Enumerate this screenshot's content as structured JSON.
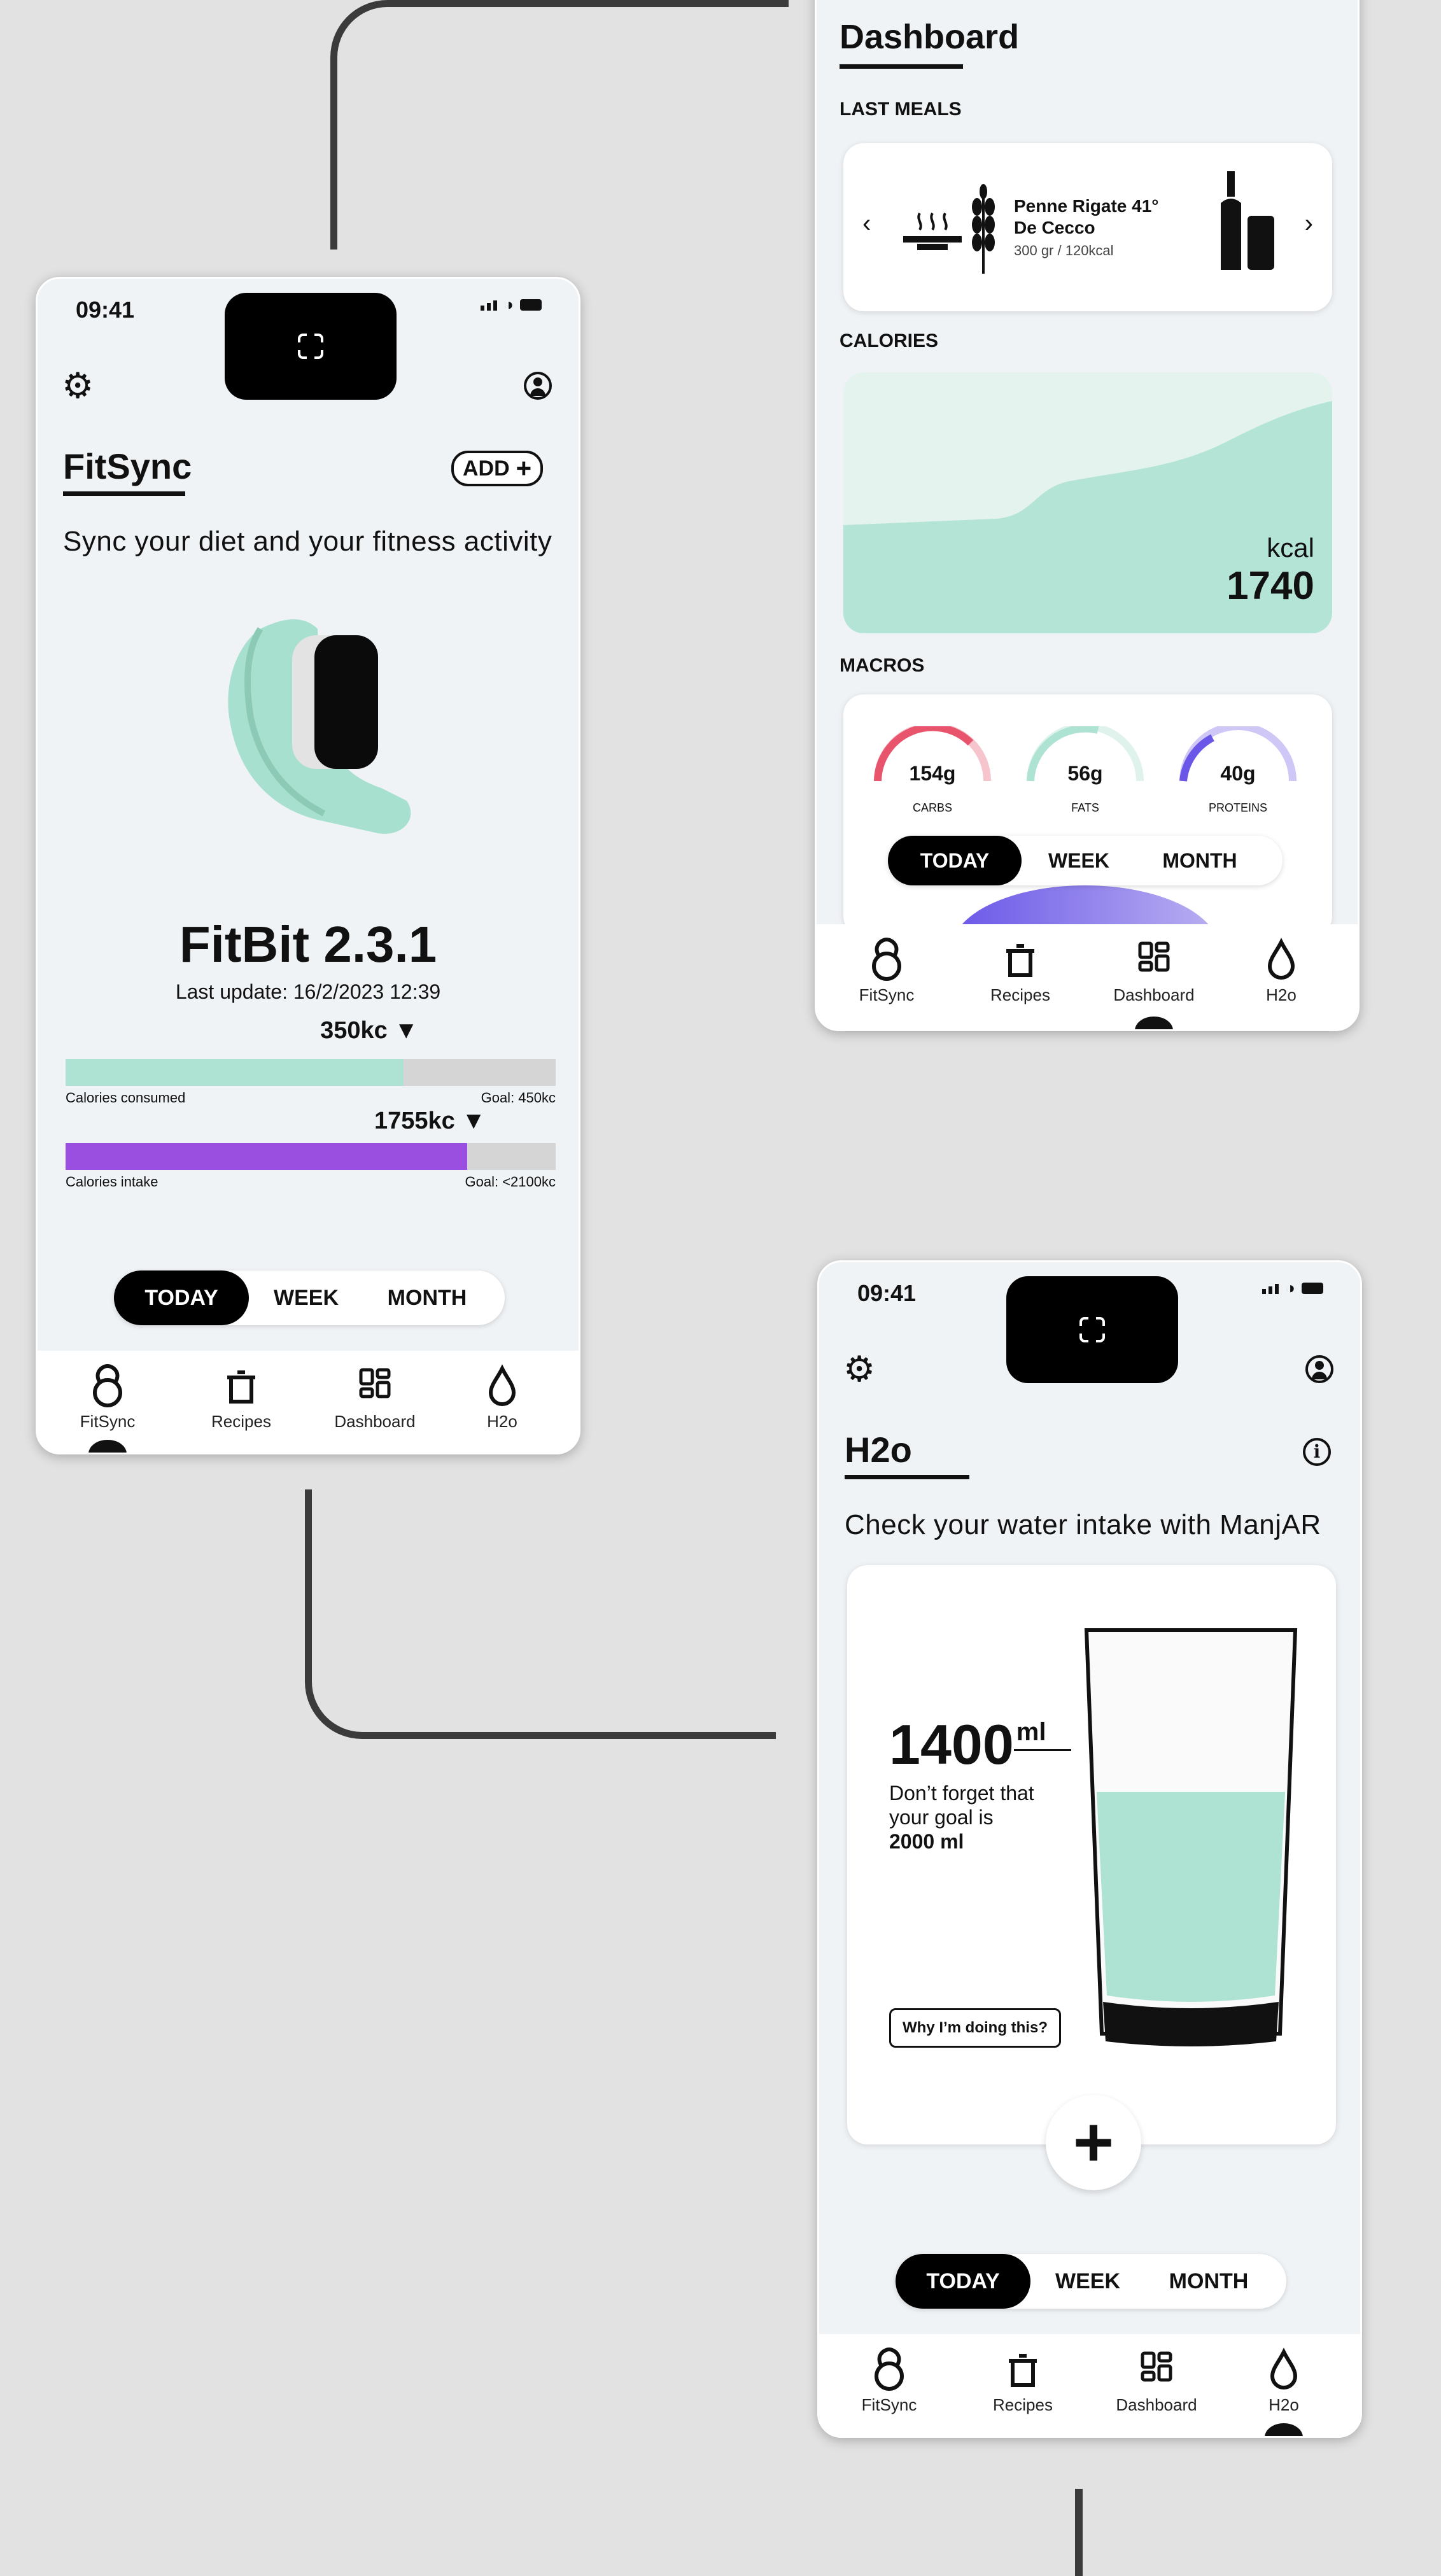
{
  "status": {
    "time": "09:41"
  },
  "nav": {
    "items": [
      {
        "label": "FitSync",
        "icon": "kettlebell-icon"
      },
      {
        "label": "Recipes",
        "icon": "pot-icon"
      },
      {
        "label": "Dashboard",
        "icon": "grid-icon"
      },
      {
        "label": "H2o",
        "icon": "water-drop-icon"
      }
    ]
  },
  "segment": {
    "options": [
      "TODAY",
      "WEEK",
      "MONTH"
    ],
    "selected": "TODAY"
  },
  "fitsync": {
    "title": "FitSync",
    "add_label": "ADD",
    "subtitle": "Sync your diet and your fitness activity",
    "device_name": "FitBit 2.3.1",
    "last_update": "Last update: 16/2/2023  12:39",
    "bars": [
      {
        "marker": "350kc",
        "label": "Calories consumed",
        "goal": "Goal: 450kc",
        "fill": 0.69,
        "color": "#aee3d3"
      },
      {
        "marker": "1755kc",
        "label": "Calories intake",
        "goal": "Goal: <2100kc",
        "fill": 0.82,
        "color": "#9a4fe0"
      }
    ]
  },
  "dashboard": {
    "title": "Dashboard",
    "last_meals_label": "LAST MEALS",
    "meal": {
      "name": "Penne Rigate 41° De Cecco",
      "detail": "300 gr / 120kcal"
    },
    "calories_label": "CALORIES",
    "calories_unit": "kcal",
    "calories_value": "1740",
    "macros_label": "MACROS",
    "macros": [
      {
        "value": "154g",
        "name": "CARBS",
        "color": "#e8546c"
      },
      {
        "value": "56g",
        "name": "FATS",
        "color": "#aee3d3"
      },
      {
        "value": "40g",
        "name": "PROTEINS",
        "color": "#6a57e8"
      }
    ]
  },
  "h2o": {
    "title": "H2o",
    "subtitle": "Check your water intake with ManjAR",
    "amount": "1400",
    "unit": "ml",
    "reminder_line1": "Don’t forget that",
    "reminder_line2": "your goal is",
    "goal": "2000 ml",
    "why_button": "Why I’m doing this?",
    "fill": 0.7
  },
  "colors": {
    "accent_mint": "#aee3d3",
    "accent_purple": "#9a4fe0",
    "background": "#e2e2e2"
  }
}
